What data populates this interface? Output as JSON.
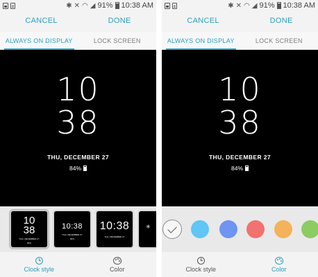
{
  "status_bar": {
    "battery": "91%",
    "time": "10:38 AM"
  },
  "action_bar": {
    "cancel_label": "CANCEL",
    "done_label": "DONE"
  },
  "tabs": [
    {
      "label": "ALWAYS ON DISPLAY",
      "active": true
    },
    {
      "label": "LOCK SCREEN",
      "active": false
    }
  ],
  "preview": {
    "hour": "10",
    "minute": "38",
    "date": "THU, DECEMBER 27",
    "battery": "84%"
  },
  "clock_styles": [
    {
      "top": "10",
      "bottom": "38",
      "caption": "THU, DECEMBER 27",
      "selected": true
    },
    {
      "top": "10:38",
      "selected": false
    },
    {
      "top": "10:38",
      "selected": false
    }
  ],
  "color_swatches": [
    {
      "name": "white",
      "color": "#f7f7f7",
      "selected": true
    },
    {
      "name": "sky-blue",
      "color": "#5fc6f5",
      "selected": false
    },
    {
      "name": "periwinkle",
      "color": "#6f94f2",
      "selected": false
    },
    {
      "name": "coral",
      "color": "#f27171",
      "selected": false
    },
    {
      "name": "orange",
      "color": "#f4b25a",
      "selected": false
    },
    {
      "name": "green",
      "color": "#8ccc62",
      "selected": false
    }
  ],
  "bottom_tabs": {
    "clock_style_label": "Clock style",
    "color_label": "Color"
  },
  "colors": {
    "accent": "#2a9fbd",
    "preview_bg": "#000000"
  }
}
